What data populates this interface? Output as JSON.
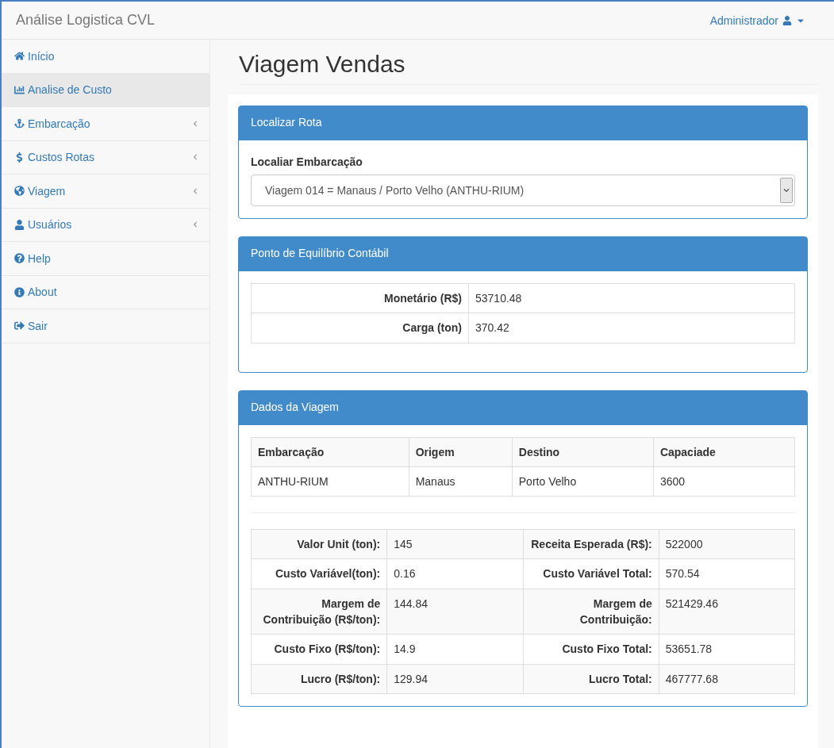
{
  "navbar": {
    "brand": "Análise Logistica CVL",
    "user": "Administrador"
  },
  "sidebar": {
    "items": [
      {
        "label": "Início",
        "selected": false,
        "submenu": false
      },
      {
        "label": "Analise de Custo",
        "selected": true,
        "submenu": false
      },
      {
        "label": "Embarcação",
        "selected": false,
        "submenu": true
      },
      {
        "label": "Custos Rotas",
        "selected": false,
        "submenu": true
      },
      {
        "label": "Viagem",
        "selected": false,
        "submenu": true
      },
      {
        "label": "Usuários",
        "selected": false,
        "submenu": true
      },
      {
        "label": "Help",
        "selected": false,
        "submenu": false
      },
      {
        "label": "About",
        "selected": false,
        "submenu": false
      },
      {
        "label": "Sair",
        "selected": false,
        "submenu": false
      }
    ]
  },
  "page_title": "Viagem Vendas",
  "localizar_panel": {
    "title": "Localizar Rota",
    "field_label": "Localiar Embarcação",
    "select_value": "Viagem 014 = Manaus / Porto Velho (ANTHU-RIUM)"
  },
  "equilibrio_panel": {
    "title": "Ponto de Equilíbrio Contábil",
    "rows": [
      {
        "label": "Monetário (R$)",
        "value": "53710.48"
      },
      {
        "label": "Carga (ton)",
        "value": "370.42"
      }
    ]
  },
  "dados_panel": {
    "title": "Dados da Viagem",
    "columns": [
      "Embarcação",
      "Origem",
      "Destino",
      "Capaciade"
    ],
    "rows": [
      [
        "ANTHU-RIUM",
        "Manaus",
        "Porto Velho",
        "3600"
      ]
    ],
    "details": [
      [
        "Valor Unit (ton):",
        "145",
        "Receita Esperada (R$):",
        "522000"
      ],
      [
        "Custo Variável(ton):",
        "0.16",
        "Custo Variável Total:",
        "570.54"
      ],
      [
        "Margem de Contribuição (R$/ton):",
        "144.84",
        "Margem de Contribuição:",
        "521429.46"
      ],
      [
        "Custo Fixo (R$/ton):",
        "14.9",
        "Custo Fixo Total:",
        "53651.78"
      ],
      [
        "Lucro (R$/ton):",
        "129.94",
        "Lucro Total:",
        "467777.68"
      ]
    ]
  }
}
